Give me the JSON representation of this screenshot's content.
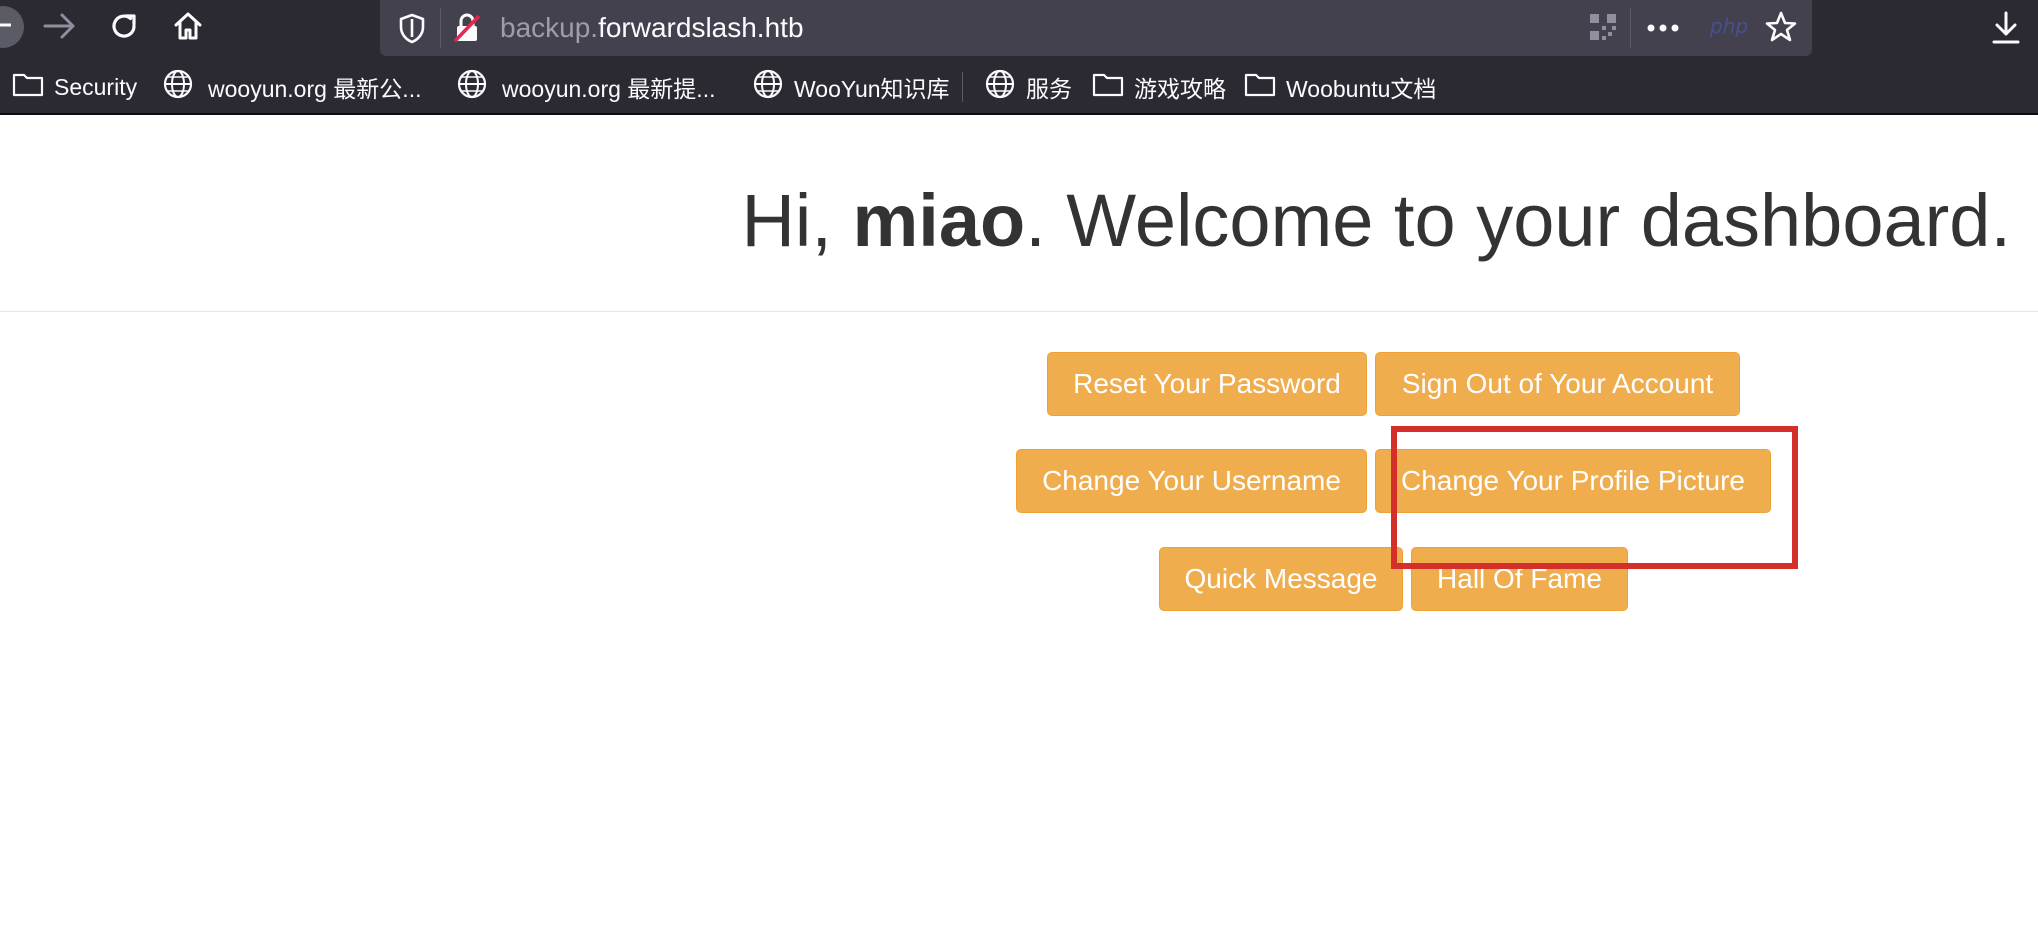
{
  "browser": {
    "url_subdomain": "backup.",
    "url_domain": "forwardslash.htb",
    "php_badge": "php",
    "icons": {
      "back": "back-icon",
      "forward": "forward-arrow-icon",
      "reload": "reload-icon",
      "home": "home-icon",
      "shield": "shield-icon",
      "insecure_lock": "insecure-lock-icon",
      "qr": "qr-code-icon",
      "more": "more-dots-icon",
      "star": "star-icon",
      "download": "download-icon"
    },
    "bookmarks": [
      {
        "label": "Security",
        "icon": "folder-icon"
      },
      {
        "label": "wooyun.org 最新公...",
        "icon": "globe-icon"
      },
      {
        "label": "wooyun.org 最新提...",
        "icon": "globe-icon"
      },
      {
        "label": "WooYun知识库",
        "icon": "globe-icon"
      },
      {
        "label": "服务",
        "icon": "globe-icon"
      },
      {
        "label": "游戏攻略",
        "icon": "folder-icon"
      },
      {
        "label": "Woobuntu文档",
        "icon": "folder-icon"
      }
    ]
  },
  "page": {
    "greeting": "Hi, ",
    "username": "miao",
    "welcome": ". Welcome to your dashboard."
  },
  "buttons": {
    "reset_password": "Reset Your Password",
    "sign_out": "Sign Out of Your Account",
    "change_username": "Change Your Username",
    "change_profile_picture": "Change Your Profile Picture",
    "quick_message": "Quick Message",
    "hall_of_fame": "Hall Of Fame"
  },
  "colors": {
    "button_bg": "#f0ad4e",
    "button_border": "#eea236",
    "highlight": "#d42f28",
    "chrome_bg": "#2b2a33",
    "urlbar_bg": "#42414d"
  }
}
